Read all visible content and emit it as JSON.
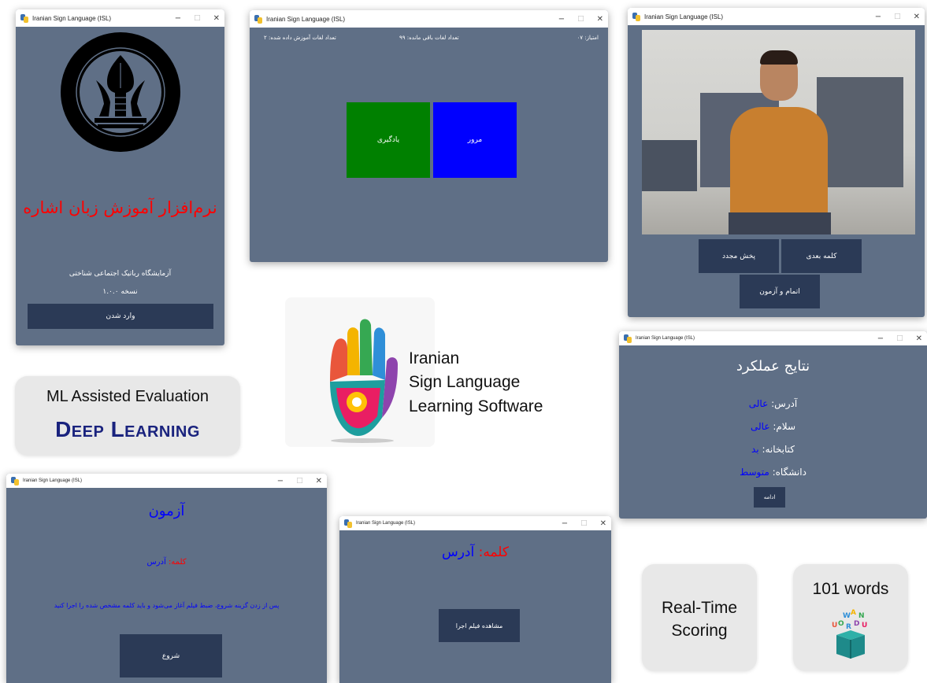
{
  "window_title": "Iranian Sign Language (ISL)",
  "title_controls": {
    "minimize": "−",
    "maximize": "□",
    "close": "✕"
  },
  "splash": {
    "app_name": "نرم‌افزار آموزش زبان اشاره",
    "lab_name": "آزمایشگاه رباتیک اجتماعی شناختی",
    "version": "نسخه ۱.۰.۰",
    "enter_label": "وارد شدن"
  },
  "menu": {
    "score": "امتیاز: ۰۷",
    "remaining": "تعداد لغات باقی مانده: ۹۹",
    "learned": "تعداد لغات آموزش داده شده: ۲",
    "learn_label": "یادگیری",
    "review_label": "مرور",
    "learn_color": "#008000",
    "review_color": "#0000ff"
  },
  "player": {
    "next_word_label": "کلمه بعدی",
    "replay_label": "پخش مجدد",
    "finish_label": "اتمام و آزمون"
  },
  "logo": {
    "line1": "Iranian",
    "line2": "Sign Language",
    "line3": "Learning Software"
  },
  "results": {
    "title": "نتایج عملکرد",
    "items": [
      {
        "word": "آدرس:",
        "grade": "عالی"
      },
      {
        "word": "سلام:",
        "grade": "عالی"
      },
      {
        "word": "کتابخانه:",
        "grade": "بد"
      },
      {
        "word": "دانشگاه:",
        "grade": "متوسط"
      }
    ],
    "continue_label": "ادامه"
  },
  "ml_card": {
    "line1": "ML Assisted Evaluation",
    "line2": "Deep Learning"
  },
  "exam": {
    "title": "آزمون",
    "word_label": "کلمه:",
    "word_value": "آدرس",
    "instruction": "پس از زدن گزینه شروع، ضبط فیلم آغاز می‌شود و باید کلمه مشخص شده را اجرا کنید",
    "start_label": "شروع"
  },
  "word_view": {
    "word_label": "کلمه:",
    "word_value": "آدرس",
    "watch_label": "مشاهده فیلم اجرا"
  },
  "realtime_card": {
    "line1": "Real-Time",
    "line2": "Scoring"
  },
  "words_card": {
    "line1": "101 words"
  },
  "colors": {
    "window_bg": "#5f6f86",
    "button_bg": "#2b3a56",
    "red": "#ff0000",
    "blue": "#0000ff"
  }
}
